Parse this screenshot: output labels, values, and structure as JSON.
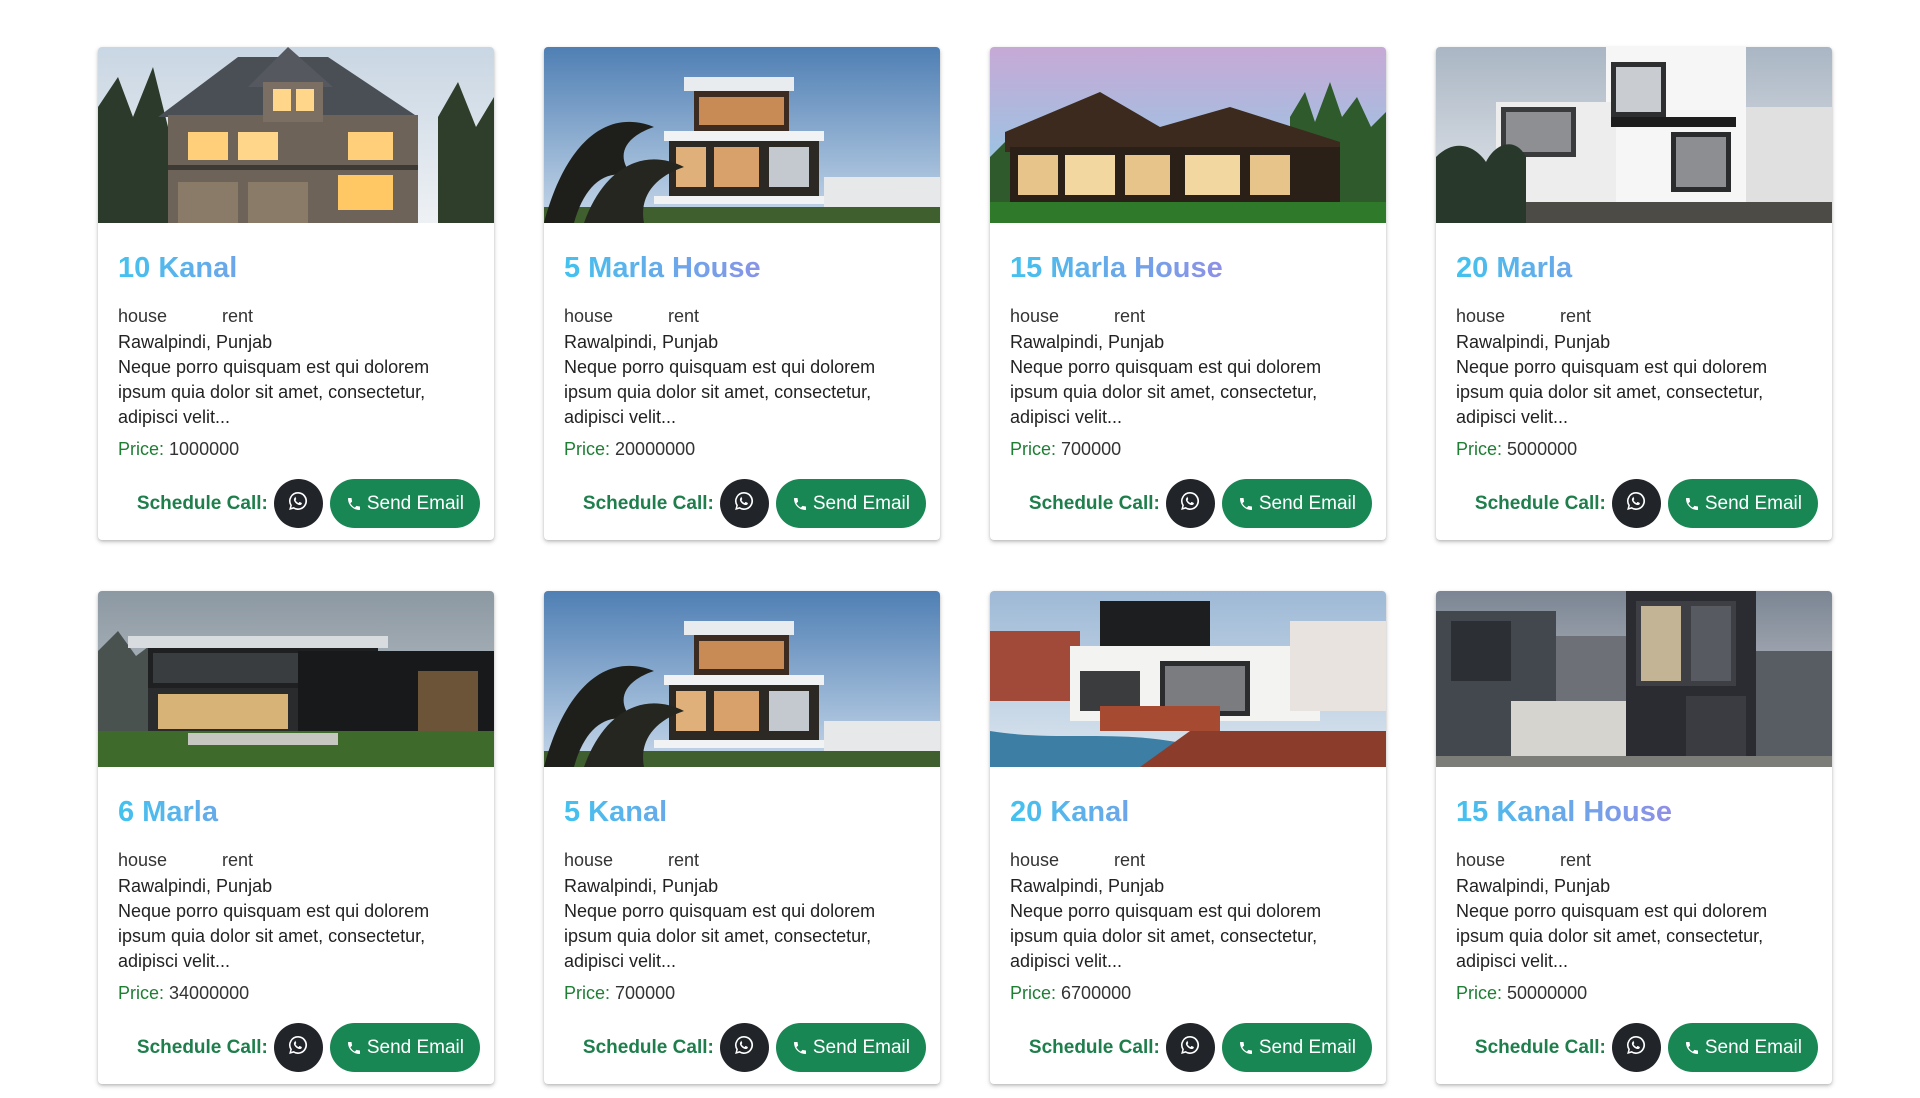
{
  "labels": {
    "schedule_call": "Schedule Call:",
    "send_email": "Send Email",
    "price_label": "Price:"
  },
  "icons": {
    "call": "whatsapp-icon",
    "email_button": "phone-icon"
  },
  "colors": {
    "title_gradient_start": "#43c2ee",
    "title_gradient_end": "#b48de4",
    "price_label": "#1e7e34",
    "schedule_label": "#1e7e4c",
    "whatsapp_button": "#212529",
    "email_button": "#198754"
  },
  "listings": [
    {
      "title": "10 Kanal",
      "type": "house",
      "purpose": "rent",
      "location": "Rawalpindi, Punjab",
      "description": "Neque porro quisquam est qui dolorem ipsum quia dolor sit amet, consectetur, adipisci velit...",
      "price": "1000000",
      "image": "stone-house-dusk"
    },
    {
      "title": "5 Marla House",
      "type": "house",
      "purpose": "rent",
      "location": "Rawalpindi, Punjab",
      "description": "Neque porro quisquam est qui dolorem ipsum quia dolor sit amet, consectetur, adipisci velit...",
      "price": "20000000",
      "image": "modern-house-trees"
    },
    {
      "title": "15 Marla House",
      "type": "house",
      "purpose": "rent",
      "location": "Rawalpindi, Punjab",
      "description": "Neque porro quisquam est qui dolorem ipsum quia dolor sit amet, consectetur, adipisci velit...",
      "price": "700000",
      "image": "glass-pavilion-house"
    },
    {
      "title": "20 Marla",
      "type": "house",
      "purpose": "rent",
      "location": "Rawalpindi, Punjab",
      "description": "Neque porro quisquam est qui dolorem ipsum quia dolor sit amet, consectetur, adipisci velit...",
      "price": "5000000",
      "image": "white-modern-villa"
    },
    {
      "title": "6 Marla",
      "type": "house",
      "purpose": "rent",
      "location": "Rawalpindi, Punjab",
      "description": "Neque porro quisquam est qui dolorem ipsum quia dolor sit amet, consectetur, adipisci velit...",
      "price": "34000000",
      "image": "dark-modern-house-lawn"
    },
    {
      "title": "5 Kanal",
      "type": "house",
      "purpose": "rent",
      "location": "Rawalpindi, Punjab",
      "description": "Neque porro quisquam est qui dolorem ipsum quia dolor sit amet, consectetur, adipisci velit...",
      "price": "700000",
      "image": "modern-house-trees"
    },
    {
      "title": "20 Kanal",
      "type": "house",
      "purpose": "rent",
      "location": "Rawalpindi, Punjab",
      "description": "Neque porro quisquam est qui dolorem ipsum quia dolor sit amet, consectetur, adipisci velit...",
      "price": "6700000",
      "image": "white-house-pool"
    },
    {
      "title": "15 Kanal House",
      "type": "house",
      "purpose": "rent",
      "location": "Rawalpindi, Punjab",
      "description": "Neque porro quisquam est qui dolorem ipsum quia dolor sit amet, consectetur, adipisci velit...",
      "price": "50000000",
      "image": "grey-modern-house-garage"
    }
  ]
}
